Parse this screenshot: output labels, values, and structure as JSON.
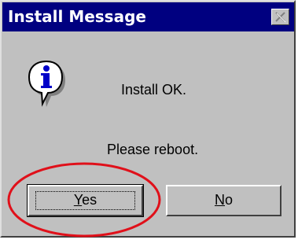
{
  "window": {
    "title": "Install Message",
    "close_icon": "close-icon"
  },
  "message": {
    "icon": "info-icon",
    "line1": "Install OK.",
    "line2": "Please reboot."
  },
  "buttons": {
    "yes_accel": "Y",
    "yes_rest": "es",
    "no_accel": "N",
    "no_rest": "o"
  },
  "colors": {
    "title_bar": "#000080",
    "dialog_face": "#c0c0c0",
    "annotation_ellipse": "#e0101a"
  }
}
